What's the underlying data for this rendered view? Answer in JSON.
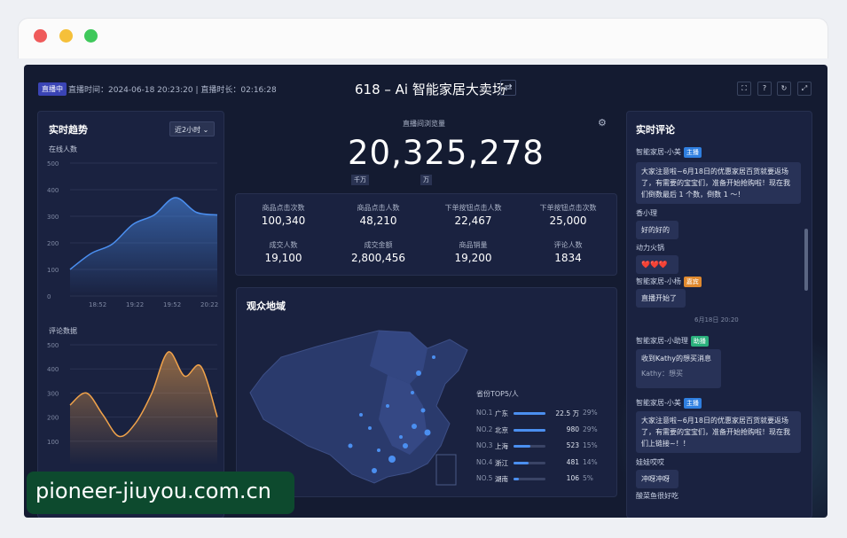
{
  "header": {
    "badge": "直播中",
    "info": "直播时间：2024-06-18 20:23:20 | 直播时长：02:16:28",
    "title": "618 – Ai 智能家居大卖场"
  },
  "trend": {
    "title": "实时趋势",
    "range_select": "近2小时",
    "online_label": "在线人数",
    "comment_label": "评论数据",
    "online_yticks": [
      "500",
      "400",
      "300",
      "200",
      "100",
      "0"
    ],
    "comment_yticks": [
      "500",
      "400",
      "300",
      "200",
      "100"
    ],
    "xticks": [
      "18:52",
      "19:22",
      "19:52",
      "20:22"
    ]
  },
  "chart_data": [
    {
      "type": "area",
      "name": "在线人数",
      "categories": [
        "18:52",
        "19:22",
        "19:52",
        "20:22"
      ],
      "values": [
        100,
        160,
        195,
        270,
        305,
        370,
        315,
        305
      ],
      "ylim": [
        0,
        500
      ],
      "color": "#4b8ff0"
    },
    {
      "type": "area",
      "name": "评论数据",
      "values": [
        250,
        300,
        210,
        120,
        175,
        300,
        470,
        370,
        410,
        200
      ],
      "ylim": [
        0,
        500
      ],
      "color": "#f0a24a"
    }
  ],
  "views": {
    "label": "直播间浏览量",
    "value": "20,325,278",
    "unit_qw": "千万",
    "unit_w": "万"
  },
  "stats": [
    {
      "label": "商品点击次数",
      "value": "100,340"
    },
    {
      "label": "商品点击人数",
      "value": "48,210"
    },
    {
      "label": "下单按钮点击人数",
      "value": "22,467"
    },
    {
      "label": "下单按钮点击次数",
      "value": "25,000"
    },
    {
      "label": "成交人数",
      "value": "19,100"
    },
    {
      "label": "成交金额",
      "value": "2,800,456"
    },
    {
      "label": "商品销量",
      "value": "19,200"
    },
    {
      "label": "评论人数",
      "value": "1834"
    }
  ],
  "map": {
    "title": "观众地域",
    "top5_title": "省份TOP5/人",
    "rows": [
      {
        "rank": "NO.1",
        "prov": "广东",
        "value": "22.5 万",
        "pct": "29%",
        "fill": 0.29
      },
      {
        "rank": "NO.2",
        "prov": "北京",
        "value": "980",
        "pct": "29%",
        "fill": 0.29
      },
      {
        "rank": "NO.3",
        "prov": "上海",
        "value": "523",
        "pct": "15%",
        "fill": 0.15
      },
      {
        "rank": "NO.4",
        "prov": "浙江",
        "value": "481",
        "pct": "14%",
        "fill": 0.14
      },
      {
        "rank": "NO.5",
        "prov": "湖南",
        "value": "106",
        "pct": "5%",
        "fill": 0.05
      }
    ]
  },
  "comments": {
    "title": "实时评论",
    "items": [
      {
        "user": "智能家居-小美",
        "tag": "主播",
        "tag_type": "host",
        "text": "大家注意啦~6月18日的优惠家居百货就要返场了，有需要的宝宝们，准备开始抢购啦！现在我们倒数最后 1 个数，倒数 1 ～！"
      },
      {
        "user": "香小理",
        "text": "好的好的"
      },
      {
        "user": "动力火锅",
        "text": "❤️❤️❤️"
      },
      {
        "user": "智能家居-小杨",
        "tag": "嘉宾",
        "tag_type": "out",
        "text": "直播开始了"
      },
      {
        "time": "6月18日  20:20"
      },
      {
        "user": "智能家居-小助理",
        "tag": "助播",
        "tag_type": "ass",
        "text": "收到Kathy的想买消息",
        "sub": "Kathy：想买"
      },
      {
        "user": "智能家居-小美",
        "tag": "主播",
        "tag_type": "host",
        "text": "大家注意啦~6月18日的优惠家居百货就要返场了，有需要的宝宝们，准备开始抢购啦！现在我们上链接~！！"
      },
      {
        "user": "娃娃哎哎",
        "text": "冲呀冲呀"
      },
      {
        "user": "酸菜鱼很好吃"
      }
    ]
  },
  "watermark": "pioneer-jiuyou.com.cn"
}
